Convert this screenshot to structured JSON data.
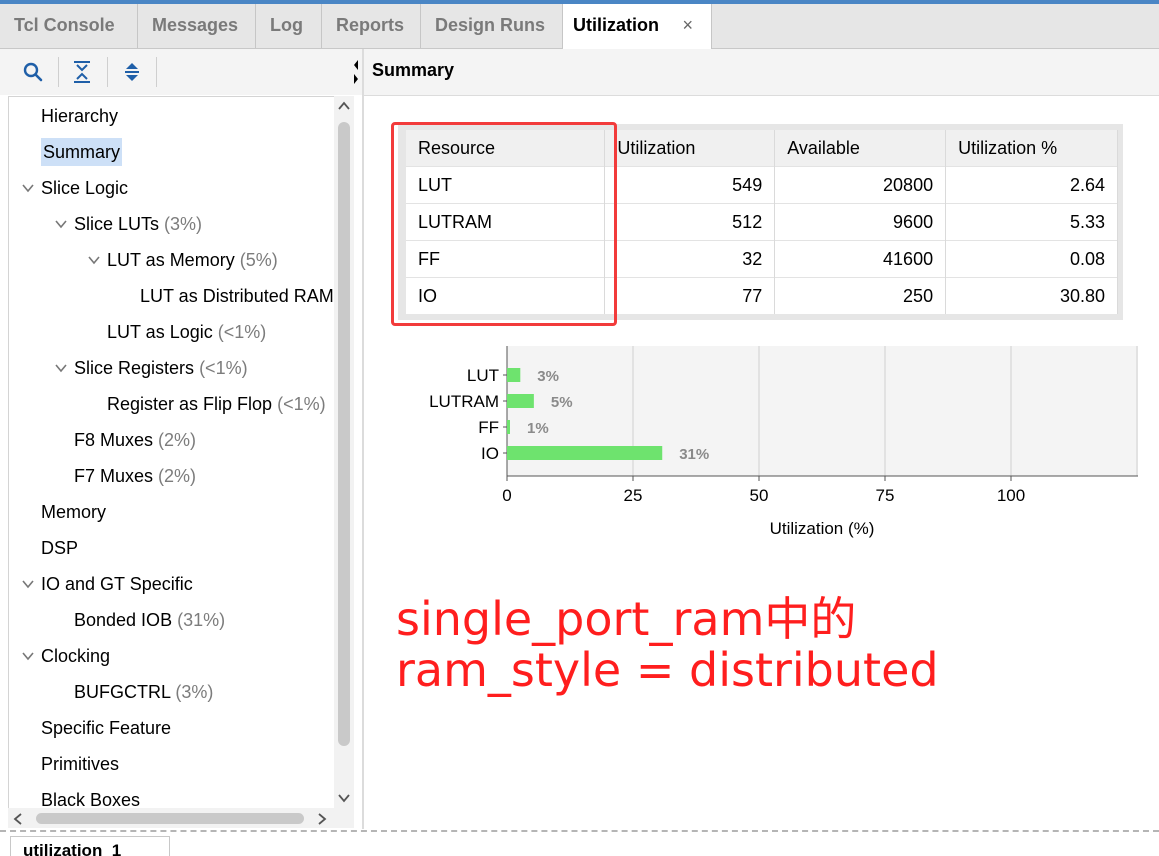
{
  "tabs": [
    {
      "label": "Tcl Console"
    },
    {
      "label": "Messages"
    },
    {
      "label": "Log"
    },
    {
      "label": "Reports"
    },
    {
      "label": "Design Runs"
    },
    {
      "label": "Utilization",
      "close": "×"
    }
  ],
  "panel_title": "Summary",
  "tree": {
    "hierarchy": {
      "label": "Hierarchy"
    },
    "summary": {
      "label": "Summary"
    },
    "slice_logic": {
      "label": "Slice Logic"
    },
    "slice_luts": {
      "label": "Slice LUTs",
      "pct": "(3%)"
    },
    "lut_as_memory": {
      "label": "LUT as Memory",
      "pct": "(5%)"
    },
    "lut_as_dist_ram": {
      "label": "LUT as Distributed RAM"
    },
    "lut_as_logic": {
      "label": "LUT as Logic",
      "pct": "(<1%)"
    },
    "slice_registers": {
      "label": "Slice Registers",
      "pct": "(<1%)"
    },
    "register_ff": {
      "label": "Register as Flip Flop",
      "pct": "(<1%)"
    },
    "f8": {
      "label": "F8 Muxes",
      "pct": "(2%)"
    },
    "f7": {
      "label": "F7 Muxes",
      "pct": "(2%)"
    },
    "memory": {
      "label": "Memory"
    },
    "dsp": {
      "label": "DSP"
    },
    "io_gt": {
      "label": "IO and GT Specific"
    },
    "bonded_iob": {
      "label": "Bonded IOB",
      "pct": "(31%)"
    },
    "clocking": {
      "label": "Clocking"
    },
    "bufgctrl": {
      "label": "BUFGCTRL",
      "pct": "(3%)"
    },
    "specific_feature": {
      "label": "Specific Feature"
    },
    "primitives": {
      "label": "Primitives"
    },
    "black_boxes": {
      "label": "Black Boxes"
    }
  },
  "table": {
    "headers": [
      "Resource",
      "Utilization",
      "Available",
      "Utilization %"
    ],
    "rows": [
      [
        "LUT",
        "549",
        "20800",
        "2.64"
      ],
      [
        "LUTRAM",
        "512",
        "9600",
        "5.33"
      ],
      [
        "FF",
        "32",
        "41600",
        "0.08"
      ],
      [
        "IO",
        "77",
        "250",
        "30.80"
      ]
    ]
  },
  "chart_data": {
    "type": "bar",
    "orientation": "horizontal",
    "categories": [
      "LUT",
      "LUTRAM",
      "FF",
      "IO"
    ],
    "values": [
      2.64,
      5.33,
      0.08,
      30.8
    ],
    "data_labels": [
      "3%",
      "5%",
      "1%",
      "31%"
    ],
    "xlabel": "Utilization (%)",
    "xlim": [
      0,
      125
    ],
    "xticks": [
      "0",
      "25",
      "50",
      "75",
      "100"
    ],
    "bar_color": "#6ee36e",
    "grid": true
  },
  "annotation": {
    "line1": "single_port_ram中的",
    "line2": "ram_style = distributed",
    "color": "#ff1e1e"
  },
  "bottom_tab": {
    "label": "utilization_1"
  }
}
